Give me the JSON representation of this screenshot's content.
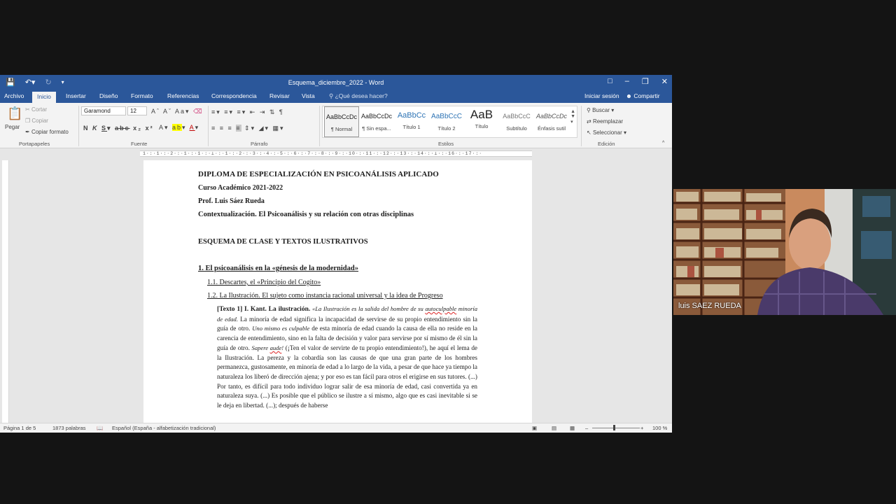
{
  "app": {
    "doc_title": "Esquema_diciembre_2022 - Word"
  },
  "tabs": [
    "Archivo",
    "Inicio",
    "Insertar",
    "Diseño",
    "Formato",
    "Referencias",
    "Correspondencia",
    "Revisar",
    "Vista"
  ],
  "tell_me": "¿Qué desea hacer?",
  "account": {
    "sign_in": "Iniciar sesión",
    "share": "Compartir"
  },
  "ribbon": {
    "clipboard": {
      "paste": "Pegar",
      "cut": "Cortar",
      "copy": "Copiar",
      "format_painter": "Copiar formato",
      "label": "Portapapeles"
    },
    "font": {
      "name": "Garamond",
      "size": "12",
      "label": "Fuente"
    },
    "paragraph": {
      "label": "Párrafo"
    },
    "styles": {
      "label": "Estilos",
      "items": [
        {
          "sample": "AaBbCcDc",
          "name": "¶ Normal"
        },
        {
          "sample": "AaBbCcDc",
          "name": "¶ Sin espa..."
        },
        {
          "sample": "AaBbCc",
          "name": "Título 1"
        },
        {
          "sample": "AaBbCcC",
          "name": "Título 2"
        },
        {
          "sample": "AaB",
          "name": "Título"
        },
        {
          "sample": "AaBbCcC",
          "name": "Subtítulo"
        },
        {
          "sample": "AaBbCcDc",
          "name": "Énfasis sutil"
        }
      ]
    },
    "editing": {
      "find": "Buscar",
      "replace": "Reemplazar",
      "select": "Seleccionar",
      "label": "Edición"
    }
  },
  "document": {
    "h1": "DIPLOMA DE ESPECIALIZACIÓN EN PSICOANÁLISIS APLICADO",
    "h2": "Curso Académico 2021-2022",
    "h3": "Prof. Luis Sáez Rueda",
    "h4": "Contextualización. El Psicoanálisis y su relación con otras disciplinas",
    "h5": "ESQUEMA DE CLASE Y TEXTOS ILUSTRATIVOS",
    "s1": "1. El psicoanálisis en la «génesis de la modernidad»",
    "s11": "1.1. Descartes, el «Principio del Cogito»",
    "s12": "1.2. La Ilustración. El sujeto como instancia racional universal y la idea de Progreso",
    "text_lead": "[Texto 1] I. Kant. La ilustración.",
    "text_i1": "«La Ilustración es la salida del hombre de su ",
    "text_i1b": "autoculpable",
    "text_i1c": " minoría de edad.",
    "text_p1": " La minoría de edad significa la incapacidad de servirse de su propio entendimiento sin la guía de otro. ",
    "text_i2": "Uno mismo es culpable",
    "text_p2": " de esta minoría de edad cuando la causa de ella no reside en la carencia de entendimiento, sino en la falta de decisión y valor para servirse por sí mismo de él sin la guía de otro. ",
    "text_i3": "Sapere ",
    "text_i3b": "aude",
    "text_i3c": "!",
    "text_p3": " (¡Ten el valor de servirte de tu propio entendimiento!), he aquí el lema de la Ilustración. La pereza y la cobardía son las causas de que una gran parte de los hombres permanezca, gustosamente, en minoría de edad a lo largo de la vida, a pesar de que hace ya tiempo la naturaleza los liberó de dirección ajena; y por eso es tan fácil para otros el erigirse en sus tutores. (...) Por tanto, es difícil para todo individuo lograr salir de esa minoría de edad, casi convertida ya en naturaleza suya. (...) Es posible que el público se ilustre a sí mismo, algo que es casi inevitable si se le deja en libertad. (...); después de haberse"
  },
  "status": {
    "page": "Página 1 de 5",
    "words": "1873 palabras",
    "language": "Español (España - alfabetización tradicional)",
    "zoom": "100 %"
  },
  "webcam": {
    "name": "luis SAEZ RUEDA"
  }
}
